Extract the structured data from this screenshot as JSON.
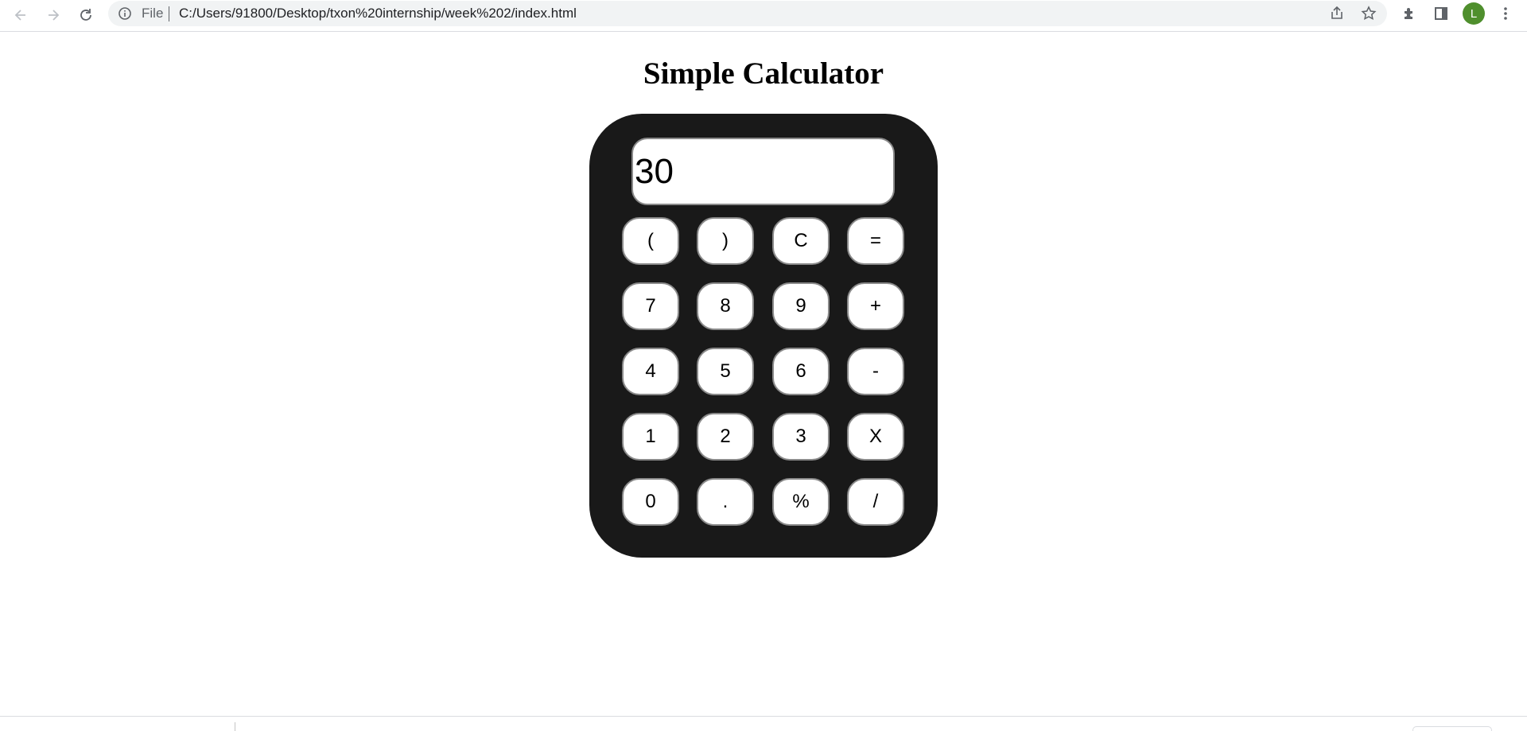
{
  "browser": {
    "scheme_label": "File",
    "url": "C:/Users/91800/Desktop/txon%20internship/week%202/index.html",
    "profile_initial": "L",
    "icons": [
      "back-arrow-icon",
      "forward-arrow-icon",
      "reload-icon",
      "info-icon",
      "share-icon",
      "star-icon",
      "extensions-icon",
      "side-panel-icon",
      "more-vertical-icon"
    ]
  },
  "page": {
    "title": "Simple Calculator"
  },
  "calculator": {
    "display_value": "30",
    "keys": [
      [
        "(",
        ")",
        "C",
        "="
      ],
      [
        "7",
        "8",
        "9",
        "+"
      ],
      [
        "4",
        "5",
        "6",
        "-"
      ],
      [
        "1",
        "2",
        "3",
        "X"
      ],
      [
        "0",
        ".",
        "%",
        "/"
      ]
    ]
  },
  "colors": {
    "calculator_body": "#191919",
    "key_background": "#ffffff",
    "key_border": "#8a8a8a",
    "avatar": "#4f8f2d"
  }
}
